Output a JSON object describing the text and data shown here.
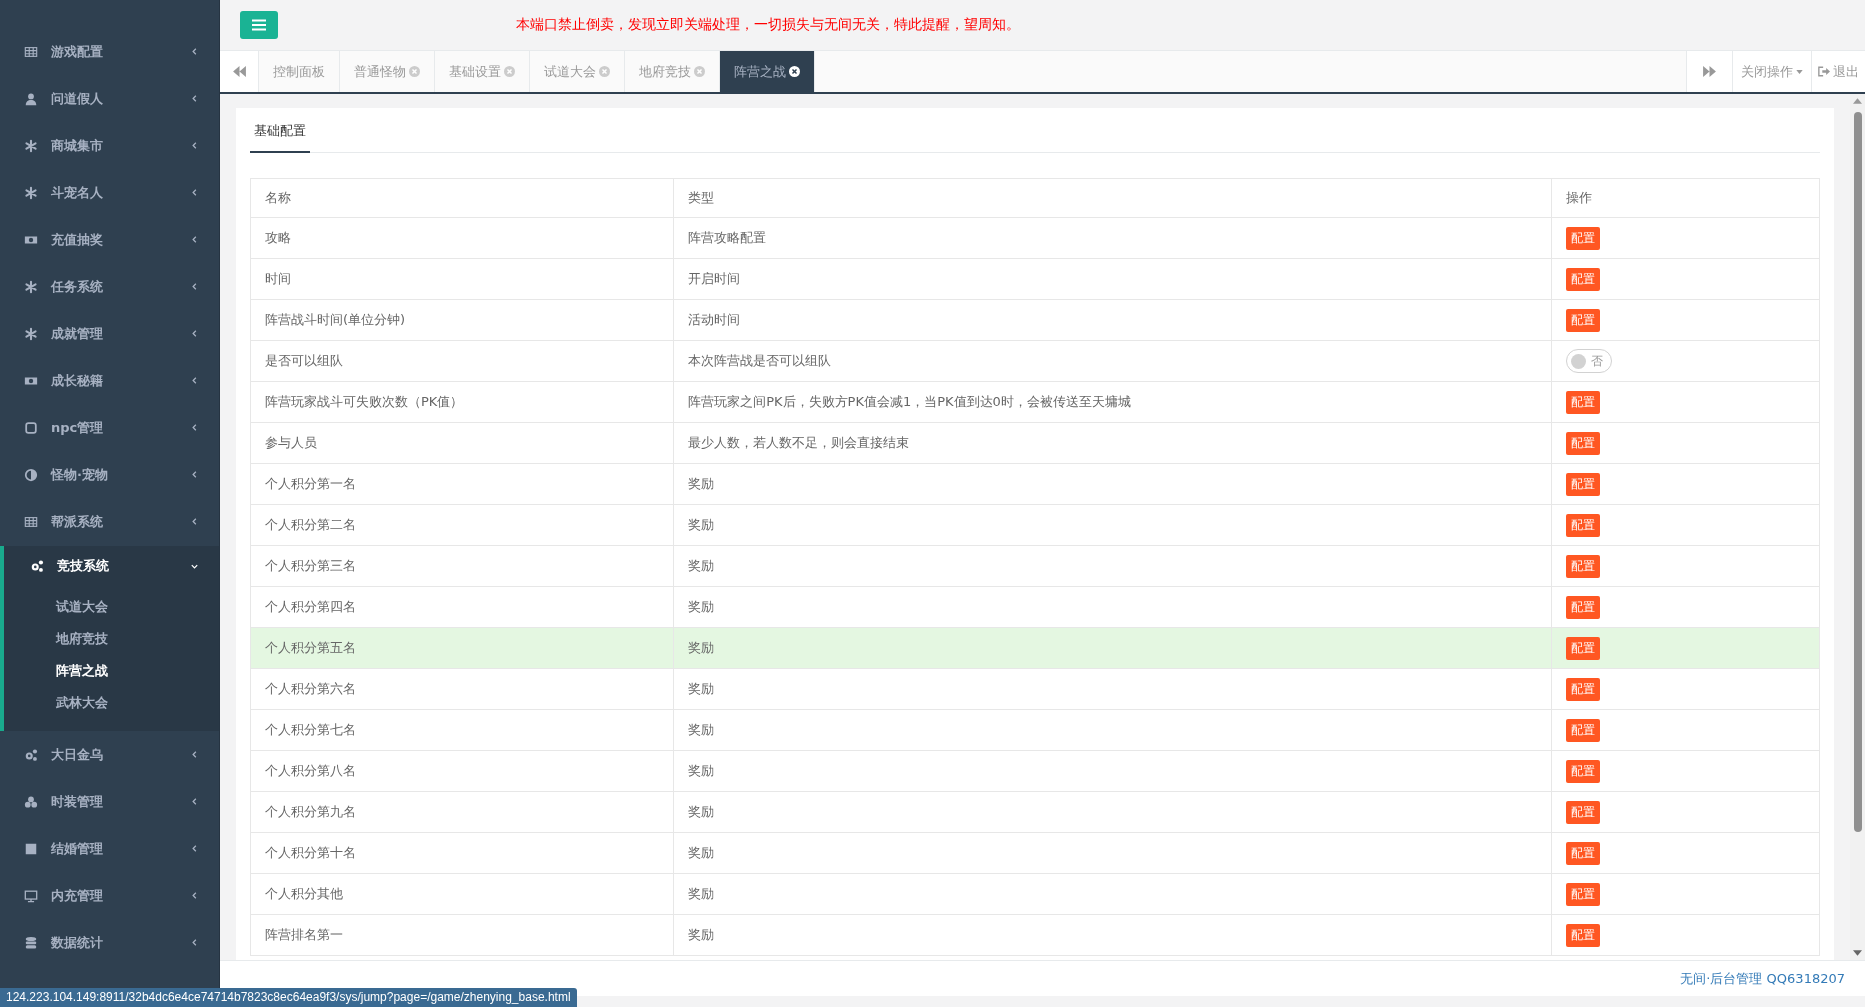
{
  "top_bar": {
    "notice": "本端口禁止倒卖，发现立即关端处理，一切损失与无间无关，特此提醒，望周知。"
  },
  "sidebar": {
    "items": [
      {
        "label": "游戏配置",
        "expanded": false
      },
      {
        "label": "问道假人",
        "expanded": false
      },
      {
        "label": "商城集市",
        "expanded": false
      },
      {
        "label": "斗宠名人",
        "expanded": false
      },
      {
        "label": "充值抽奖",
        "expanded": false
      },
      {
        "label": "任务系统",
        "expanded": false
      },
      {
        "label": "成就管理",
        "expanded": false
      },
      {
        "label": "成长秘籍",
        "expanded": false
      },
      {
        "label": "npc管理",
        "expanded": false
      },
      {
        "label": "怪物·宠物",
        "expanded": false
      },
      {
        "label": "帮派系统",
        "expanded": false
      },
      {
        "label": "竞技系统",
        "expanded": true,
        "children": [
          {
            "label": "试道大会",
            "selected": false
          },
          {
            "label": "地府竞技",
            "selected": false
          },
          {
            "label": "阵营之战",
            "selected": true
          },
          {
            "label": "武林大会",
            "selected": false
          }
        ]
      },
      {
        "label": "大日金乌",
        "expanded": false
      },
      {
        "label": "时装管理",
        "expanded": false
      },
      {
        "label": "结婚管理",
        "expanded": false
      },
      {
        "label": "内充管理",
        "expanded": false
      },
      {
        "label": "数据统计",
        "expanded": false
      }
    ]
  },
  "tabs": [
    {
      "label": "控制面板",
      "closable": false,
      "selected": false
    },
    {
      "label": "普通怪物",
      "closable": true,
      "selected": false
    },
    {
      "label": "基础设置",
      "closable": true,
      "selected": false
    },
    {
      "label": "试道大会",
      "closable": true,
      "selected": false
    },
    {
      "label": "地府竞技",
      "closable": true,
      "selected": false
    },
    {
      "label": "阵营之战",
      "closable": true,
      "selected": true
    }
  ],
  "tab_actions": {
    "close_menu": "关闭操作",
    "logout": "退出"
  },
  "panel": {
    "tab": "基础配置",
    "table": {
      "columns": [
        "名称",
        "类型",
        "操作"
      ],
      "rows": [
        {
          "name": "攻略",
          "type": "阵营攻略配置",
          "kind": "button",
          "action": "配置",
          "highlighted": false
        },
        {
          "name": "时间",
          "type": "开启时间",
          "kind": "button",
          "action": "配置",
          "highlighted": false
        },
        {
          "name": "阵营战斗时间(单位分钟)",
          "type": "活动时间",
          "kind": "button",
          "action": "配置",
          "highlighted": false
        },
        {
          "name": "是否可以组队",
          "type": "本次阵营战是否可以组队",
          "kind": "toggle",
          "action": "否",
          "on": false,
          "highlighted": false
        },
        {
          "name": "阵营玩家战斗可失败次数（PK值）",
          "type": "阵营玩家之间PK后，失败方PK值会减1，当PK值到达0时，会被传送至天墉城",
          "kind": "button",
          "action": "配置",
          "highlighted": false
        },
        {
          "name": "参与人员",
          "type": "最少人数，若人数不足，则会直接结束",
          "kind": "button",
          "action": "配置",
          "highlighted": false
        },
        {
          "name": "个人积分第一名",
          "type": "奖励",
          "kind": "button",
          "action": "配置",
          "highlighted": false
        },
        {
          "name": "个人积分第二名",
          "type": "奖励",
          "kind": "button",
          "action": "配置",
          "highlighted": false
        },
        {
          "name": "个人积分第三名",
          "type": "奖励",
          "kind": "button",
          "action": "配置",
          "highlighted": false
        },
        {
          "name": "个人积分第四名",
          "type": "奖励",
          "kind": "button",
          "action": "配置",
          "highlighted": false
        },
        {
          "name": "个人积分第五名",
          "type": "奖励",
          "kind": "button",
          "action": "配置",
          "highlighted": true
        },
        {
          "name": "个人积分第六名",
          "type": "奖励",
          "kind": "button",
          "action": "配置",
          "highlighted": false
        },
        {
          "name": "个人积分第七名",
          "type": "奖励",
          "kind": "button",
          "action": "配置",
          "highlighted": false
        },
        {
          "name": "个人积分第八名",
          "type": "奖励",
          "kind": "button",
          "action": "配置",
          "highlighted": false
        },
        {
          "name": "个人积分第九名",
          "type": "奖励",
          "kind": "button",
          "action": "配置",
          "highlighted": false
        },
        {
          "name": "个人积分第十名",
          "type": "奖励",
          "kind": "button",
          "action": "配置",
          "highlighted": false
        },
        {
          "name": "个人积分其他",
          "type": "奖励",
          "kind": "button",
          "action": "配置",
          "highlighted": false
        },
        {
          "name": "阵营排名第一",
          "type": "奖励",
          "kind": "button",
          "action": "配置",
          "highlighted": false
        }
      ]
    }
  },
  "footer": "无间·后台管理 QQ6318207",
  "status_url": "124.223.104.149:8911/32b4dc6e4ce74714b7823c8ec64ea9f3/sys/jump?page=/game/zhenying_base.html"
}
